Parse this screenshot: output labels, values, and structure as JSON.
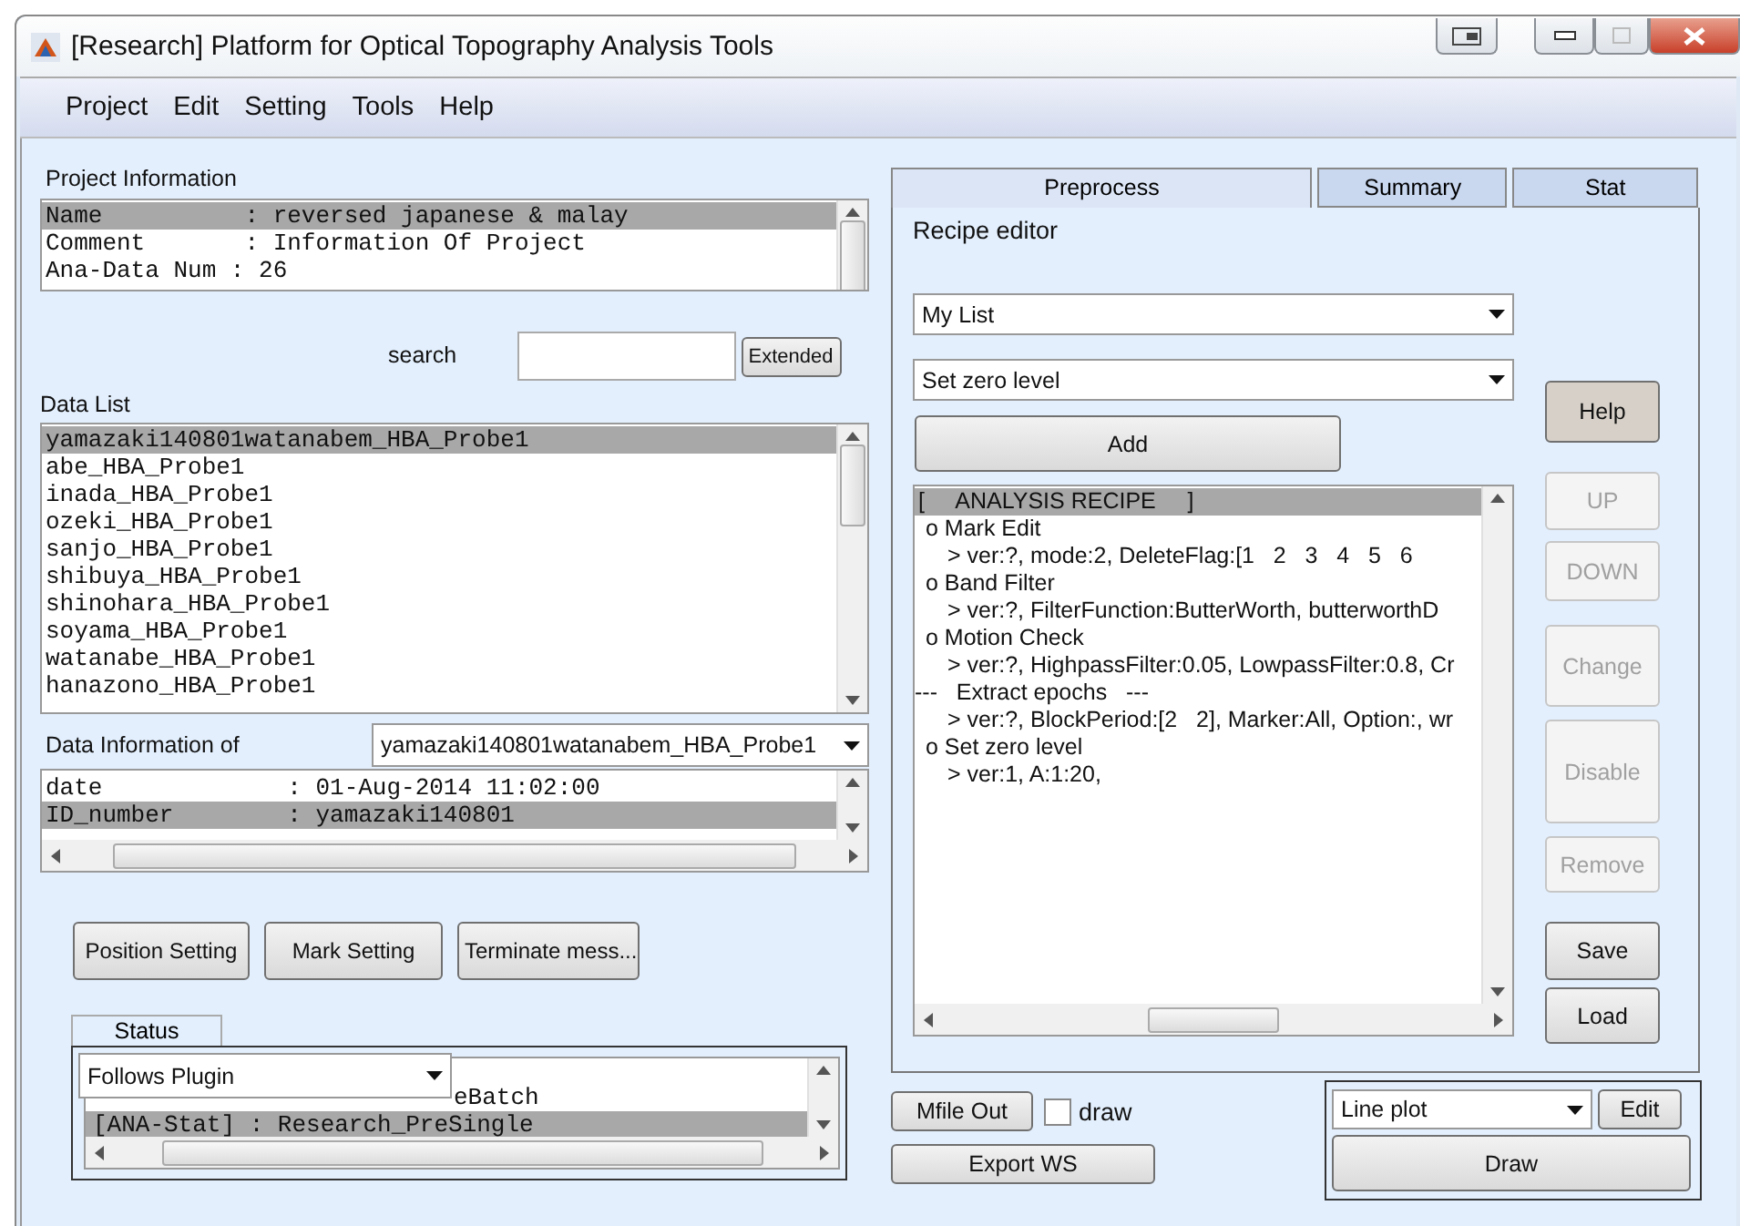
{
  "window": {
    "title": "[Research] Platform for Optical Topography Analysis Tools"
  },
  "menu": [
    "Project",
    "Edit",
    "Setting",
    "Tools",
    "Help"
  ],
  "project_information": {
    "label": "Project Information",
    "rows": [
      {
        "text": "Name          : reversed japanese & malay",
        "selected": true
      },
      {
        "text": "Comment       : Information Of Project",
        "selected": false
      },
      {
        "text": "Ana-Data Num : 26",
        "selected": false
      }
    ]
  },
  "search": {
    "label": "search",
    "extended_button": "Extended"
  },
  "data_list": {
    "label": "Data List",
    "items": [
      {
        "text": "yamazaki140801watanabem_HBA_Probe1",
        "selected": true
      },
      {
        "text": "abe_HBA_Probe1",
        "selected": false
      },
      {
        "text": "inada_HBA_Probe1",
        "selected": false
      },
      {
        "text": "ozeki_HBA_Probe1",
        "selected": false
      },
      {
        "text": "sanjo_HBA_Probe1",
        "selected": false
      },
      {
        "text": "shibuya_HBA_Probe1",
        "selected": false
      },
      {
        "text": "shinohara_HBA_Probe1",
        "selected": false
      },
      {
        "text": "soyama_HBA_Probe1",
        "selected": false
      },
      {
        "text": "watanabe_HBA_Probe1",
        "selected": false
      },
      {
        "text": "hanazono_HBA_Probe1",
        "selected": false
      }
    ]
  },
  "data_information": {
    "label": "Data Information of",
    "dropdown": "yamazaki140801watanabem_HBA_Probe1",
    "rows": [
      {
        "text": "date             : 01-Aug-2014 11:02:00",
        "selected": false
      },
      {
        "text": "ID_number        : yamazaki140801",
        "selected": true
      }
    ]
  },
  "buttons": [
    "Position Setting",
    "Mark Setting",
    "Terminate mess..."
  ],
  "status": {
    "label": "Status",
    "dropdown": "Follows Plugin",
    "rows": [
      {
        "text": "eBatch",
        "selected": false
      },
      {
        "text": "[ANA-Stat] : Research_PreSingle",
        "selected": true
      }
    ]
  },
  "tabs": [
    {
      "label": "Preprocess",
      "selected": true
    },
    {
      "label": "Summary",
      "selected": false
    },
    {
      "label": "Stat",
      "selected": false
    }
  ],
  "recipe_editor": {
    "label": "Recipe editor",
    "list_dropdown": "My List",
    "function_dropdown": "Set zero level",
    "add_button": "Add",
    "recipe": [
      {
        "kind": "header",
        "text": "[     ANALYSIS RECIPE     ]",
        "selected": true
      },
      {
        "kind": "step",
        "text": "o Mark Edit",
        "selected": false
      },
      {
        "kind": "param",
        "text": "> ver:?, mode:2, DeleteFlag:[1   2   3   4   5   6",
        "selected": false
      },
      {
        "kind": "step",
        "text": "o Band Filter",
        "selected": false
      },
      {
        "kind": "param",
        "text": "> ver:?, FilterFunction:ButterWorth, butterworthD",
        "selected": false
      },
      {
        "kind": "step",
        "text": "o Motion Check",
        "selected": false
      },
      {
        "kind": "param",
        "text": "> ver:?, HighpassFilter:0.05, LowpassFilter:0.8, Cr",
        "selected": false
      },
      {
        "kind": "separator",
        "text": "---   Extract epochs   ---",
        "selected": false
      },
      {
        "kind": "param",
        "text": "> ver:?, BlockPeriod:[2   2], Marker:All, Option:, wr",
        "selected": false
      },
      {
        "kind": "step",
        "text": "o Set zero level",
        "selected": false
      },
      {
        "kind": "param",
        "text": "> ver:1, A:1:20,",
        "selected": false
      }
    ]
  },
  "side_buttons": [
    {
      "label": "Help",
      "disabled": false
    },
    {
      "label": "UP",
      "disabled": true
    },
    {
      "label": "DOWN",
      "disabled": true
    },
    {
      "label": "Change",
      "disabled": true
    },
    {
      "label": "Disable",
      "disabled": true
    },
    {
      "label": "Remove",
      "disabled": true
    },
    {
      "label": "Save",
      "disabled": false
    },
    {
      "label": "Load",
      "disabled": false
    }
  ],
  "mfile_out_button": "Mfile Out",
  "draw_checkbox": {
    "label": "draw",
    "checked": false
  },
  "export_button": "Export WS",
  "plot": {
    "dropdown": "Line plot",
    "edit_button": "Edit",
    "draw_button": "Draw"
  }
}
